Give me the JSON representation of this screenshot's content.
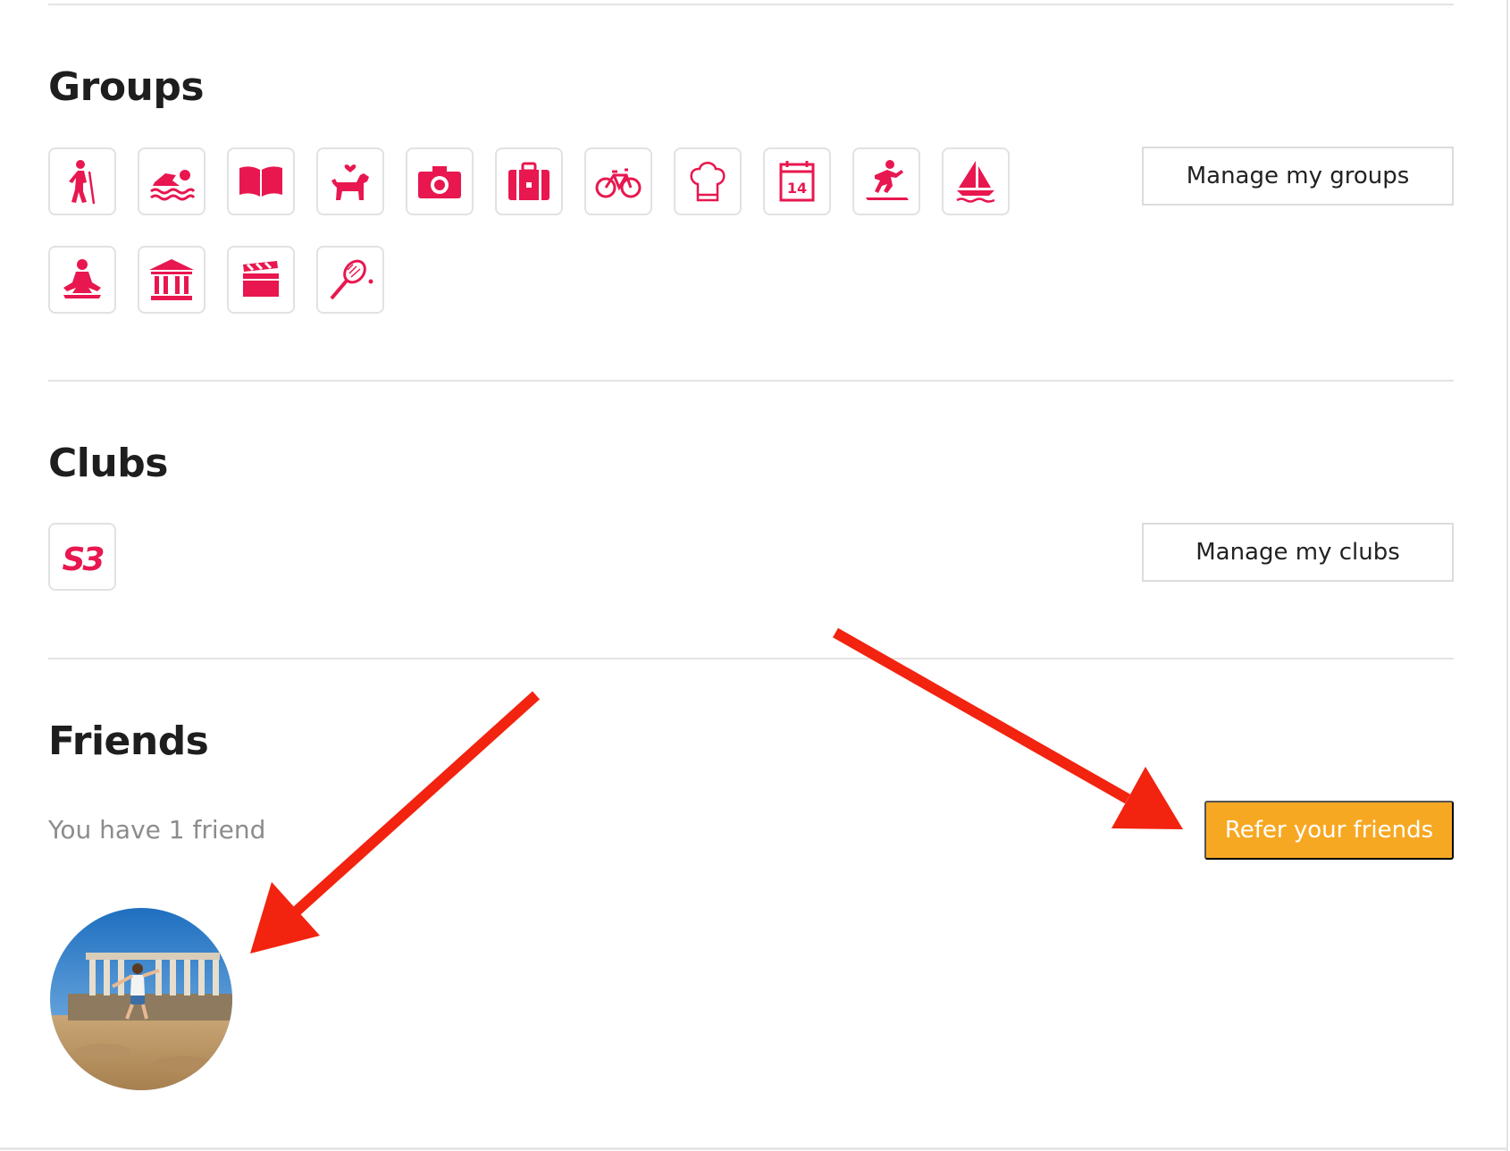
{
  "groups": {
    "title": "Groups",
    "manage_label": "Manage my groups",
    "icons": [
      "hiking-icon",
      "swimming-icon",
      "book-icon",
      "dog-icon",
      "camera-icon",
      "suitcase-icon",
      "bicycle-icon",
      "chef-hat-icon",
      "calendar-icon",
      "surfing-icon",
      "sailboat-icon",
      "yoga-icon",
      "museum-icon",
      "clapperboard-icon",
      "tennis-icon"
    ],
    "calendar_day": "14"
  },
  "clubs": {
    "title": "Clubs",
    "manage_label": "Manage my clubs",
    "club_logo_text": "S3"
  },
  "friends": {
    "title": "Friends",
    "count_text": "You have 1 friend",
    "refer_label": "Refer your friends"
  },
  "colors": {
    "accent_icon": "#e8174f",
    "refer_button": "#f7a823",
    "annotation_arrow": "#f2230f"
  }
}
